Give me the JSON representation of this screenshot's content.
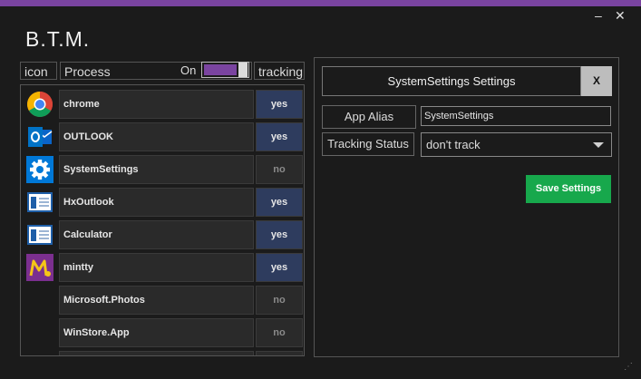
{
  "app": {
    "title": "B.T.M.",
    "accent_color": "#7a44a0"
  },
  "window_controls": {
    "minimize": "–",
    "close": "✕"
  },
  "list_header": {
    "icon": "icon",
    "process": "Process",
    "toggle_label": "On",
    "tracking": "tracking"
  },
  "processes": [
    {
      "name": "chrome",
      "tracking": "yes",
      "icon": "chrome-icon"
    },
    {
      "name": "OUTLOOK",
      "tracking": "yes",
      "icon": "outlook-icon"
    },
    {
      "name": "SystemSettings",
      "tracking": "no",
      "icon": "gear-icon"
    },
    {
      "name": "HxOutlook",
      "tracking": "yes",
      "icon": "window-icon"
    },
    {
      "name": "Calculator",
      "tracking": "yes",
      "icon": "window-icon"
    },
    {
      "name": "mintty",
      "tracking": "yes",
      "icon": "mintty-icon"
    },
    {
      "name": "Microsoft.Photos",
      "tracking": "no",
      "icon": ""
    },
    {
      "name": "WinStore.App",
      "tracking": "no",
      "icon": ""
    }
  ],
  "settings": {
    "title": "SystemSettings Settings",
    "close_label": "X",
    "alias_label": "App Alias",
    "alias_value": "SystemSettings",
    "tracking_label": "Tracking Status",
    "tracking_value": "don't track",
    "save_label": "Save Settings"
  },
  "colors": {
    "yes_bg": "#2e3c5e",
    "save_bg": "#17a84c"
  }
}
